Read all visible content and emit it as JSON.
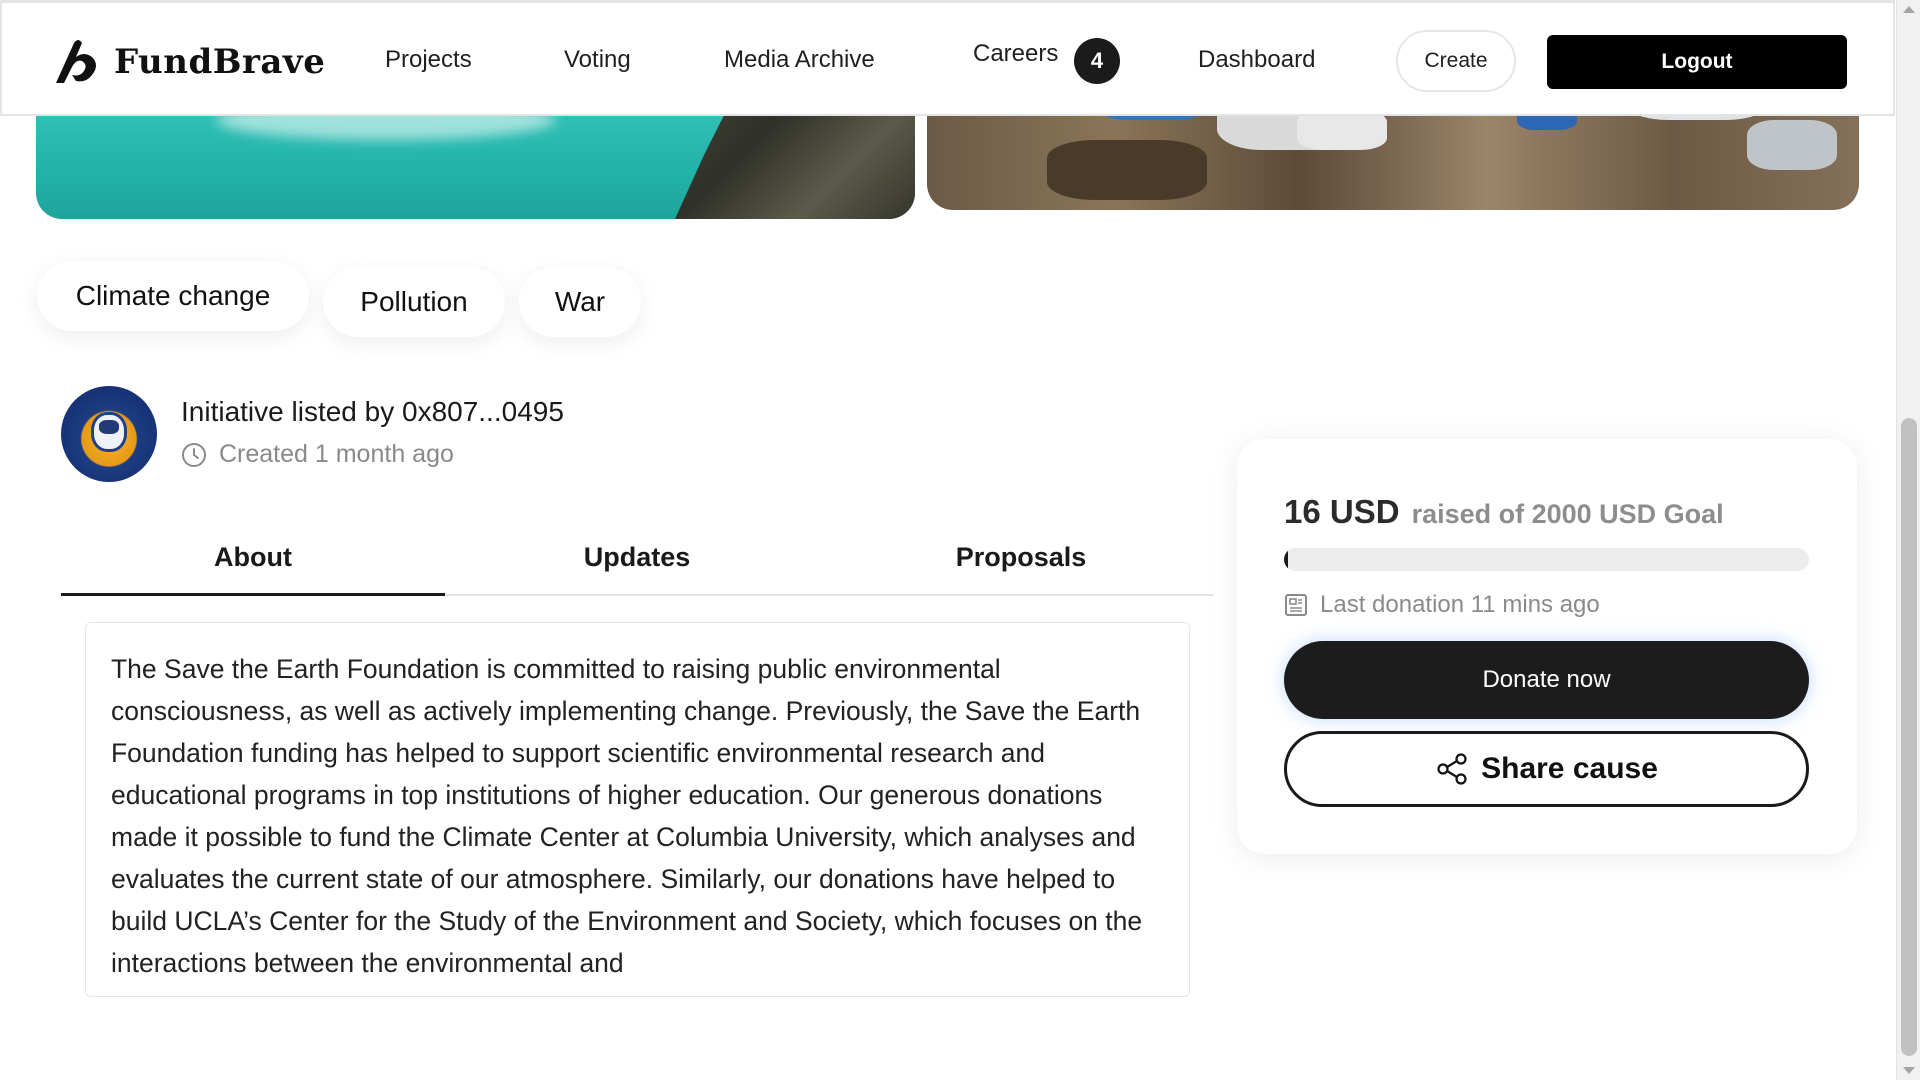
{
  "header": {
    "brand": "FundBrave",
    "nav": [
      {
        "label": "Projects"
      },
      {
        "label": "Voting"
      },
      {
        "label": "Media Archive"
      },
      {
        "label": "Careers",
        "badge": "4"
      },
      {
        "label": "Dashboard"
      }
    ],
    "create_label": "Create",
    "logout_label": "Logout"
  },
  "tags": [
    "Climate change",
    "Pollution",
    "War"
  ],
  "listing": {
    "listed_by": "Initiative listed by 0x807...0495",
    "created": "Created 1 month ago"
  },
  "tabs": [
    {
      "label": "About",
      "active": true
    },
    {
      "label": "Updates",
      "active": false
    },
    {
      "label": "Proposals",
      "active": false
    }
  ],
  "about": {
    "text": "The Save the Earth Foundation is committed to raising public environmental consciousness, as well as actively implementing change. Previously, the Save the Earth Foundation funding has helped to support scientific environmental research and educational programs in top institutions of higher education. Our generous donations made it possible to fund the Climate Center at Columbia University, which analyses and evaluates the current state of our atmosphere. Similarly, our donations have helped to build UCLA’s Center for the Study of the Environment and Society, which focuses on the interactions between the environmental and"
  },
  "donation": {
    "raised": "16 USD",
    "goal_text": "raised of 2000 USD Goal",
    "progress_fraction": 0.008,
    "last_donation": "Last donation 11 mins ago",
    "donate_label": "Donate now",
    "share_label": "Share cause"
  },
  "colors": {
    "primary": "#000000",
    "muted_text": "#8a8a8a",
    "progress_track": "#ececec"
  },
  "icons": [
    "fundbrave-logo-icon",
    "clock-icon",
    "receipt-icon",
    "share-icon"
  ]
}
